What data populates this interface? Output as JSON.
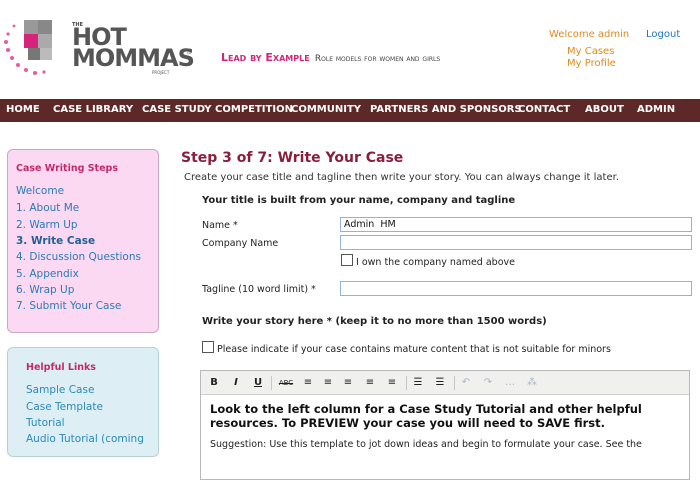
{
  "brand": {
    "logo_the": "THE",
    "logo_hot": "HOT",
    "logo_mommas": "MOMMAS",
    "logo_tm": "™",
    "logo_project": "PROJECT",
    "tagline_emph": "Lead by Example",
    "tagline_rest": "Role models for women and girls",
    "accent_color": "#d6247b"
  },
  "user": {
    "welcome": "Welcome admin",
    "logout": "Logout",
    "my_cases": "My Cases",
    "my_profile": "My Profile"
  },
  "nav": {
    "bg_color": "#5c2828",
    "items": [
      "HOME",
      "CASE LIBRARY",
      "CASE STUDY COMPETITION",
      "COMMUNITY",
      "PARTNERS AND SPONSORS",
      "CONTACT",
      "ABOUT",
      "ADMIN"
    ]
  },
  "steps": {
    "title": "Case Writing Steps",
    "items": [
      "Welcome",
      "1. About Me",
      "2. Warm Up",
      "3. Write Case",
      "4. Discussion Questions",
      "5. Appendix",
      "6. Wrap Up",
      "7. Submit Your Case"
    ],
    "active_index": 3
  },
  "helpful": {
    "title": "Helpful Links",
    "items": [
      "Sample Case",
      "Case Template",
      "Tutorial",
      "Audio Tutorial (coming"
    ]
  },
  "main": {
    "step_title": "Step 3 of 7: Write Your Case",
    "step_subtitle": "Create your case title and tagline then write your story. You can always change it later.",
    "title_section": "Your title is built from your name, company and tagline",
    "name_label": "Name *",
    "name_value": "Admin  HM",
    "company_label": "Company Name",
    "company_value": "",
    "own_company_label": "I own the company named above",
    "tagline_label": "Tagline (10 word limit) *",
    "tagline_value": "",
    "story_section": "Write your story here * (keep it to no more than 1500 words)",
    "mature_label": "Please indicate if your case contains mature content that is not suitable for minors"
  },
  "editor": {
    "toolbar": [
      {
        "name": "bold-icon",
        "glyph": "B"
      },
      {
        "name": "italic-icon",
        "glyph": "I"
      },
      {
        "name": "underline-icon",
        "glyph": "U"
      },
      {
        "name": "strikethrough-icon",
        "glyph": "ABC"
      },
      {
        "name": "paste-format-icon",
        "glyph": "≡"
      },
      {
        "name": "align-left-icon",
        "glyph": "≡"
      },
      {
        "name": "align-center-icon",
        "glyph": "≡"
      },
      {
        "name": "align-right-icon",
        "glyph": "≡"
      },
      {
        "name": "align-justify-icon",
        "glyph": "≡"
      },
      {
        "name": "bullet-list-icon",
        "glyph": "☰"
      },
      {
        "name": "numbered-list-icon",
        "glyph": "☰"
      },
      {
        "name": "undo-icon",
        "glyph": "↶"
      },
      {
        "name": "redo-icon",
        "glyph": "↷"
      },
      {
        "name": "link-icon",
        "glyph": "…"
      },
      {
        "name": "unlink-icon",
        "glyph": "⁂"
      }
    ],
    "content_bold": "Look to the left column for a Case Study Tutorial and other helpful resources. To PREVIEW your case you will need to SAVE first.",
    "content_normal": "Suggestion: Use this template to jot down ideas and begin to formulate your case. See the"
  }
}
